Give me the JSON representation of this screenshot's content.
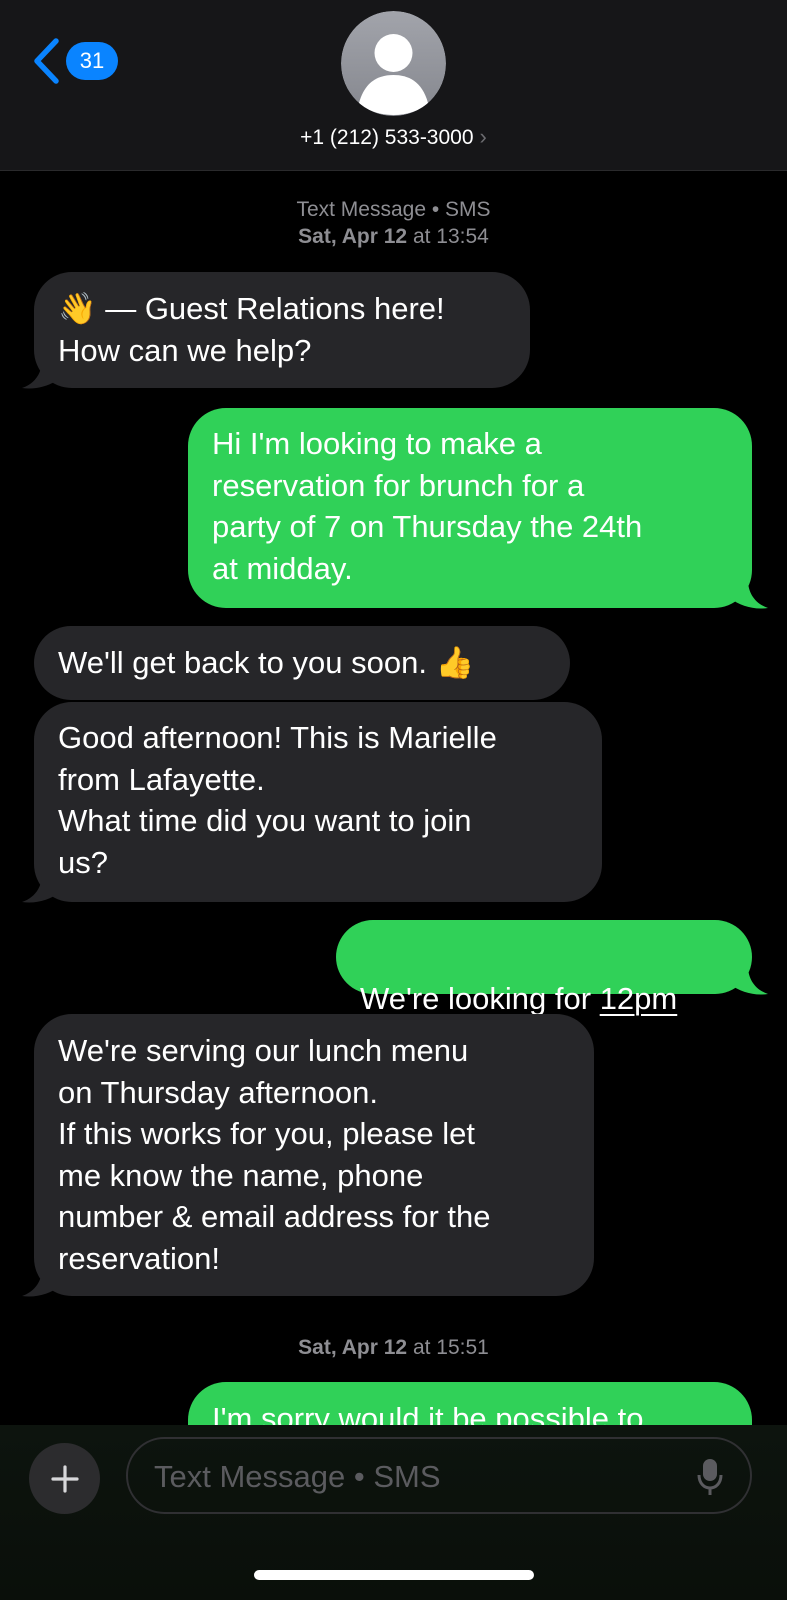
{
  "header": {
    "back_count": "31",
    "contact": "+1 (212) 533-3000",
    "contact_chevron": "›"
  },
  "thread": {
    "meta1_line1": "Text Message • SMS",
    "meta1_line2_day": "Sat, Apr 12",
    "meta1_line2_time": "at 13:54",
    "meta2_day": "Sat, Apr 12",
    "meta2_time": "at 15:51",
    "messages": [
      {
        "from": "them",
        "text": "👋 — Guest Relations here!\nHow can we help?"
      },
      {
        "from": "me",
        "text": "Hi I'm looking to make a\nreservation for brunch for a\nparty of 7 on Thursday the 24th\nat midday."
      },
      {
        "from": "them",
        "text": "We'll get back to you soon. 👍"
      },
      {
        "from": "them",
        "text": "Good afternoon!  This is Marielle\nfrom Lafayette.\nWhat time did you want to join\nus?"
      },
      {
        "from": "me",
        "text_prefix": "We're looking for ",
        "link": "12pm"
      },
      {
        "from": "them",
        "text": "We're serving our lunch menu\non Thursday afternoon.\nIf this works for you, please let\nme know the name, phone\nnumber & email address for the\nreservation!"
      },
      {
        "from": "me",
        "text": "I'm sorry would it be possible to"
      }
    ]
  },
  "composer": {
    "placeholder": "Text Message • SMS"
  },
  "colors": {
    "incoming_bubble": "#262629",
    "outgoing_bubble": "#30d158",
    "badge": "#0a84ff"
  }
}
